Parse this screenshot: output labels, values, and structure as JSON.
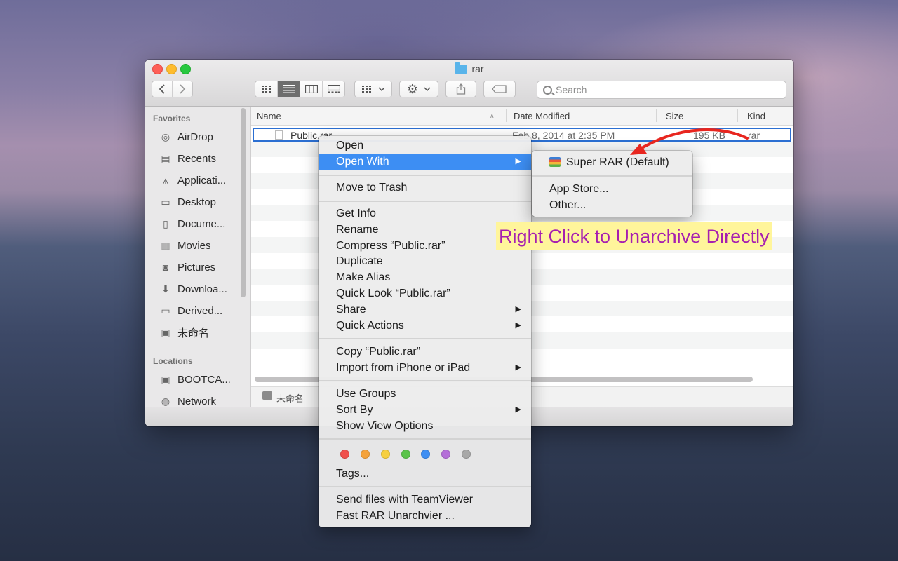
{
  "window": {
    "title": "rar"
  },
  "toolbar": {
    "search_placeholder": "Search"
  },
  "sidebar": {
    "favorites_header": "Favorites",
    "favorites": [
      {
        "label": "AirDrop",
        "icon": "airdrop-icon"
      },
      {
        "label": "Recents",
        "icon": "clock-icon"
      },
      {
        "label": "Applicati...",
        "icon": "applications-icon"
      },
      {
        "label": "Desktop",
        "icon": "desktop-icon"
      },
      {
        "label": "Docume...",
        "icon": "document-icon"
      },
      {
        "label": "Movies",
        "icon": "film-icon"
      },
      {
        "label": "Pictures",
        "icon": "camera-icon"
      },
      {
        "label": "Downloa...",
        "icon": "download-icon"
      },
      {
        "label": "Derived...",
        "icon": "folder-icon"
      },
      {
        "label": "未命名",
        "icon": "disk-icon"
      }
    ],
    "locations_header": "Locations",
    "locations": [
      {
        "label": "BOOTCA...",
        "icon": "disk-icon"
      },
      {
        "label": "Network",
        "icon": "network-icon"
      }
    ]
  },
  "columns": {
    "name": "Name",
    "date": "Date Modified",
    "size": "Size",
    "kind": "Kind"
  },
  "file": {
    "name": "Public.rar",
    "date": "Feb 8, 2014 at 2:35 PM",
    "size": "195 KB",
    "kind": "rar"
  },
  "pathbar": {
    "disk": "未命名"
  },
  "context_menu": {
    "open": "Open",
    "open_with": "Open With",
    "move_to_trash": "Move to Trash",
    "get_info": "Get Info",
    "rename": "Rename",
    "compress": "Compress “Public.rar”",
    "duplicate": "Duplicate",
    "make_alias": "Make Alias",
    "quick_look": "Quick Look “Public.rar”",
    "share": "Share",
    "quick_actions": "Quick Actions",
    "copy": "Copy “Public.rar”",
    "import": "Import from iPhone or iPad",
    "use_groups": "Use Groups",
    "sort_by": "Sort By",
    "show_view_options": "Show View Options",
    "tags": "Tags...",
    "teamviewer": "Send files with TeamViewer",
    "fast_rar": "Fast RAR Unarchvier ...",
    "tag_colors": [
      "#f0504d",
      "#f4a23a",
      "#f6cf3f",
      "#5ac44a",
      "#3d8ef3",
      "#b46fd8",
      "#a8a8a8"
    ]
  },
  "submenu": {
    "super_rar": "Super RAR (Default)",
    "app_store": "App Store...",
    "other": "Other..."
  },
  "callout": {
    "text": "Right Click to Unarchive Directly"
  }
}
